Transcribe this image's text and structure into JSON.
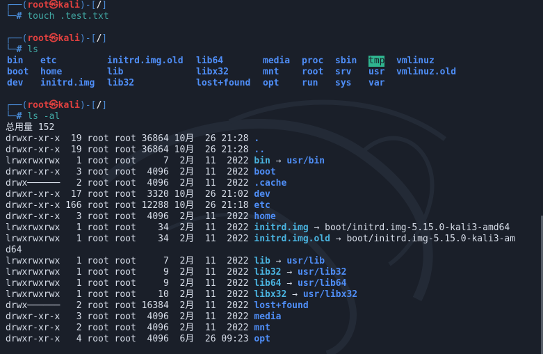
{
  "colors": {
    "background": "#1a1f29",
    "prompt_frame": "#4a8bd6",
    "prompt_user": "#e0403f",
    "command": "#41a7a3",
    "directory": "#4f8ef7",
    "symlink": "#4ab4e0",
    "tmp_highlight": "#2fb58f"
  },
  "prompts": [
    {
      "user": "root",
      "symbol": "㉿",
      "host": "kali",
      "path": "/",
      "command": "touch .test.txt"
    },
    {
      "user": "root",
      "symbol": "㉿",
      "host": "kali",
      "path": "/",
      "command": "ls"
    },
    {
      "user": "root",
      "symbol": "㉿",
      "host": "kali",
      "path": "/",
      "command": "ls -al"
    }
  ],
  "ls_output": [
    [
      "bin",
      "etc",
      "initrd.img.old",
      "lib64",
      "media",
      "proc",
      "sbin",
      "tmp",
      "vmlinuz"
    ],
    [
      "boot",
      "home",
      "lib",
      "libx32",
      "mnt",
      "root",
      "srv",
      "usr",
      "vmlinuz.old"
    ],
    [
      "dev",
      "initrd.img",
      "lib32",
      "lost+found",
      "opt",
      "run",
      "sys",
      "var",
      ""
    ]
  ],
  "total_line": "总用量 152",
  "entries": [
    {
      "text": "drwxr-xr-x  19 root root 36864 10月  26 21:28 ",
      "name": ".",
      "arrow": "",
      "target": ""
    },
    {
      "text": "drwxr-xr-x  19 root root 36864 10月  26 21:28 ",
      "name": "..",
      "arrow": "",
      "target": ""
    },
    {
      "text": "lrwxrwxrwx   1 root root     7  2月  11  2022 ",
      "name": "bin",
      "arrow": " → ",
      "target": "usr/bin"
    },
    {
      "text": "drwxr-xr-x   3 root root  4096  2月  11  2022 ",
      "name": "boot",
      "arrow": "",
      "target": ""
    },
    {
      "text": "drwx──────   2 root root  4096  2月  11  2022 ",
      "name": ".cache",
      "arrow": "",
      "target": ""
    },
    {
      "text": "drwxr-xr-x  17 root root  3320 10月  26 21:02 ",
      "name": "dev",
      "arrow": "",
      "target": ""
    },
    {
      "text": "drwxr-xr-x 166 root root 12288 10月  26 21:18 ",
      "name": "etc",
      "arrow": "",
      "target": ""
    },
    {
      "text": "drwxr-xr-x   3 root root  4096  2月  11  2022 ",
      "name": "home",
      "arrow": "",
      "target": ""
    },
    {
      "text": "lrwxrwxrwx   1 root root    34  2月  11  2022 ",
      "name": "initrd.img",
      "arrow": " → ",
      "target_plain": "boot/initrd.img-5.15.0-kali3-amd64"
    },
    {
      "text": "lrwxrwxrwx   1 root root    34  2月  11  2022 ",
      "name": "initrd.img.old",
      "arrow": " → ",
      "target_plain": "boot/initrd.img-5.15.0-kali3-am"
    },
    {
      "text": "",
      "name": "",
      "arrow": "",
      "target_plain": "d64"
    },
    {
      "text": "lrwxrwxrwx   1 root root     7  2月  11  2022 ",
      "name": "lib",
      "arrow": " → ",
      "target": "usr/lib"
    },
    {
      "text": "lrwxrwxrwx   1 root root     9  2月  11  2022 ",
      "name": "lib32",
      "arrow": " → ",
      "target": "usr/lib32"
    },
    {
      "text": "lrwxrwxrwx   1 root root     9  2月  11  2022 ",
      "name": "lib64",
      "arrow": " → ",
      "target": "usr/lib64"
    },
    {
      "text": "lrwxrwxrwx   1 root root    10  2月  11  2022 ",
      "name": "libx32",
      "arrow": " → ",
      "target": "usr/libx32"
    },
    {
      "text": "drwx──────   2 root root 16384  2月  11  2022 ",
      "name": "lost+found",
      "arrow": "",
      "target": ""
    },
    {
      "text": "drwxr-xr-x   3 root root  4096  2月  11  2022 ",
      "name": "media",
      "arrow": "",
      "target": ""
    },
    {
      "text": "drwxr-xr-x   2 root root  4096  2月  11  2022 ",
      "name": "mnt",
      "arrow": "",
      "target": ""
    },
    {
      "text": "drwxr-xr-x   4 root root  4096  6月  26 09:23 ",
      "name": "opt",
      "arrow": "",
      "target": ""
    }
  ]
}
